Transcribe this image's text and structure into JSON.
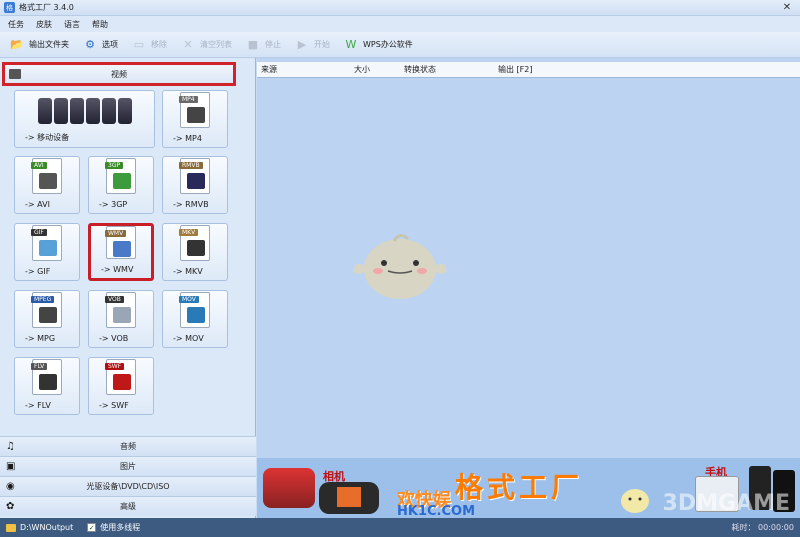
{
  "window": {
    "title": "格式工厂 3.4.0",
    "close_glyph": "✕"
  },
  "menu": [
    "任务",
    "皮肤",
    "语言",
    "帮助"
  ],
  "toolbar": [
    {
      "label": "输出文件夹",
      "icon": "folder-icon",
      "enabled": true,
      "color": "#e6a23c",
      "glyph": "📂"
    },
    {
      "label": "选项",
      "icon": "options-icon",
      "enabled": true,
      "color": "#2d6fc0",
      "glyph": "⚙"
    },
    {
      "label": "移除",
      "icon": "remove-icon",
      "enabled": false,
      "color": "#b8c2d0",
      "glyph": "▭"
    },
    {
      "label": "清空列表",
      "icon": "clear-list-icon",
      "enabled": false,
      "color": "#b8c2d0",
      "glyph": "✕"
    },
    {
      "label": "停止",
      "icon": "stop-icon",
      "enabled": false,
      "color": "#b8c2d0",
      "glyph": "■"
    },
    {
      "label": "开始",
      "icon": "start-icon",
      "enabled": false,
      "color": "#b8c2d0",
      "glyph": "▶"
    },
    {
      "label": "WPS办公软件",
      "icon": "wps-icon",
      "enabled": true,
      "color": "#3aa845",
      "glyph": "W"
    }
  ],
  "sidebar": {
    "video_header": "视频",
    "formats": [
      {
        "label": "-> 移动设备",
        "tag": "",
        "tag_color": "#000000",
        "pic_color": "#000000",
        "highlight": false
      },
      {
        "label": "-> MP4",
        "tag": "MP4",
        "tag_color": "#6a6a6a",
        "pic_color": "#444444",
        "highlight": false
      },
      {
        "label": "-> AVI",
        "tag": "AVI",
        "tag_color": "#3b8b2a",
        "pic_color": "#555555",
        "highlight": false
      },
      {
        "label": "-> 3GP",
        "tag": "3GP",
        "tag_color": "#3b8b2a",
        "pic_color": "#3d9b3d",
        "highlight": false
      },
      {
        "label": "-> RMVB",
        "tag": "RMVB",
        "tag_color": "#8a6a3a",
        "pic_color": "#2a2a5a",
        "highlight": false
      },
      {
        "label": "-> GIF",
        "tag": "GIF",
        "tag_color": "#333333",
        "pic_color": "#58a0d8",
        "highlight": false
      },
      {
        "label": "-> WMV",
        "tag": "WMV",
        "tag_color": "#8a6a3a",
        "pic_color": "#4a79c8",
        "highlight": true
      },
      {
        "label": "-> MKV",
        "tag": "MKV",
        "tag_color": "#a07b3b",
        "pic_color": "#333333",
        "highlight": false
      },
      {
        "label": "-> MPG",
        "tag": "MPEG",
        "tag_color": "#2a5aa8",
        "pic_color": "#444444",
        "highlight": false
      },
      {
        "label": "-> VOB",
        "tag": "VOB",
        "tag_color": "#333333",
        "pic_color": "#9aa6b5",
        "highlight": false
      },
      {
        "label": "-> MOV",
        "tag": "MOV",
        "tag_color": "#2a7ab8",
        "pic_color": "#2a7ab8",
        "highlight": false
      },
      {
        "label": "-> FLV",
        "tag": "FLV",
        "tag_color": "#555555",
        "pic_color": "#333333",
        "highlight": false
      },
      {
        "label": "-> SWF",
        "tag": "SWF",
        "tag_color": "#b01010",
        "pic_color": "#c01818",
        "highlight": false
      }
    ],
    "categories": [
      {
        "label": "音频",
        "icon": "music-note-icon",
        "glyph": "♫"
      },
      {
        "label": "图片",
        "icon": "picture-icon",
        "glyph": "▣"
      },
      {
        "label": "光驱设备\\DVD\\CD\\ISO",
        "icon": "disc-drive-icon",
        "glyph": "◉"
      },
      {
        "label": "高级",
        "icon": "advanced-icon",
        "glyph": "✿"
      }
    ]
  },
  "task_table": {
    "headers": [
      "来源",
      "大小",
      "转换状态",
      "输出 [F2]"
    ]
  },
  "banner": {
    "camera_label": "相机",
    "phone_label": "手机",
    "title_main": "格式工厂",
    "title_side": "欢快娱",
    "url": "HK1C.COM",
    "watermark": "3DMGAME"
  },
  "statusbar": {
    "output_path": "D:\\WNOutput",
    "multithread_label": "使用多线程",
    "multithread_checked": true,
    "right_text": "耗时： 00:00:00"
  }
}
